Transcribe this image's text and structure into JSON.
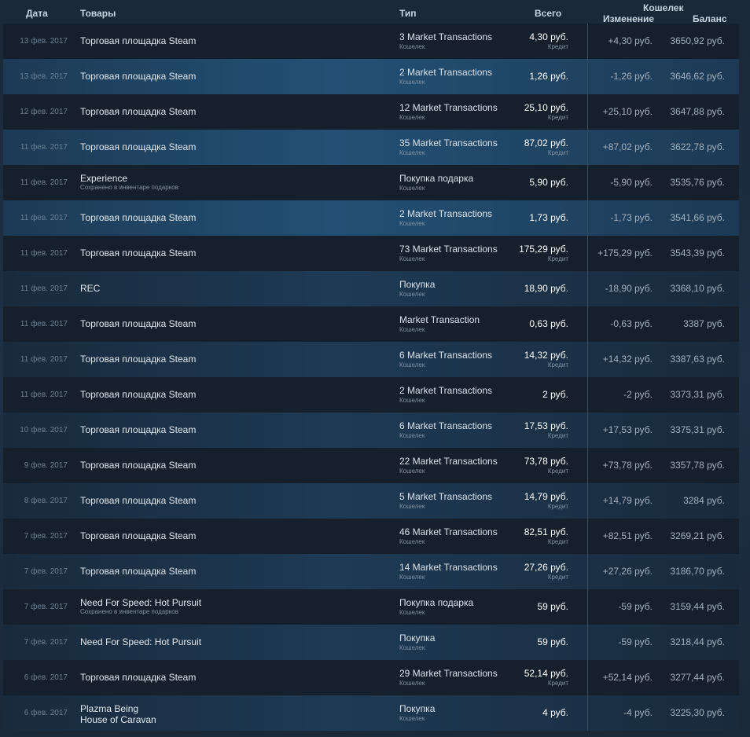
{
  "header": {
    "date": "Дата",
    "items": "Товары",
    "type": "Тип",
    "total": "Всего",
    "wallet": "Кошелек",
    "change": "Изменение",
    "balance": "Баланс"
  },
  "rows": [
    {
      "date": "13 фев. 2017",
      "item": "Торговая площадка Steam",
      "item_sub": "",
      "type": "3 Market Transactions",
      "type_sub": "Кошелек",
      "total": "4,30 руб.",
      "total_sub": "Кредит",
      "change": "+4,30 руб.",
      "balance": "3650,92 руб.",
      "style": "dark"
    },
    {
      "date": "13 фев. 2017",
      "item": "Торговая площадка Steam",
      "item_sub": "",
      "type": "2 Market Transactions",
      "type_sub": "Кошелек",
      "total": "1,26 руб.",
      "total_sub": "",
      "change": "-1,26 руб.",
      "balance": "3646,62 руб.",
      "style": "light"
    },
    {
      "date": "12 фев. 2017",
      "item": "Торговая площадка Steam",
      "item_sub": "",
      "type": "12 Market Transactions",
      "type_sub": "Кошелек",
      "total": "25,10 руб.",
      "total_sub": "Кредит",
      "change": "+25,10 руб.",
      "balance": "3647,88 руб.",
      "style": "dark"
    },
    {
      "date": "11 фев. 2017",
      "item": "Торговая площадка Steam",
      "item_sub": "",
      "type": "35 Market Transactions",
      "type_sub": "Кошелек",
      "total": "87,02 руб.",
      "total_sub": "Кредит",
      "change": "+87,02 руб.",
      "balance": "3622,78 руб.",
      "style": "light"
    },
    {
      "date": "11 фев. 2017",
      "item": "Experience",
      "item_sub": "Сохранено в инвентаре подарков",
      "type": "Покупка подарка",
      "type_sub": "Кошелек",
      "total": "5,90 руб.",
      "total_sub": "",
      "change": "-5,90 руб.",
      "balance": "3535,76 руб.",
      "style": "dark"
    },
    {
      "date": "11 фев. 2017",
      "item": "Торговая площадка Steam",
      "item_sub": "",
      "type": "2 Market Transactions",
      "type_sub": "Кошелек",
      "total": "1,73 руб.",
      "total_sub": "",
      "change": "-1,73 руб.",
      "balance": "3541,66 руб.",
      "style": "light"
    },
    {
      "date": "11 фев. 2017",
      "item": "Торговая площадка Steam",
      "item_sub": "",
      "type": "73 Market Transactions",
      "type_sub": "Кошелек",
      "total": "175,29 руб.",
      "total_sub": "Кредит",
      "change": "+175,29 руб.",
      "balance": "3543,39 руб.",
      "style": "dark"
    },
    {
      "date": "11 фев. 2017",
      "item": "REC",
      "item_sub": "",
      "type": "Покупка",
      "type_sub": "Кошелек",
      "total": "18,90 руб.",
      "total_sub": "",
      "change": "-18,90 руб.",
      "balance": "3368,10 руб.",
      "style": "mid"
    },
    {
      "date": "11 фев. 2017",
      "item": "Торговая площадка Steam",
      "item_sub": "",
      "type": "Market Transaction",
      "type_sub": "Кошелек",
      "total": "0,63 руб.",
      "total_sub": "",
      "change": "-0,63 руб.",
      "balance": "3387 руб.",
      "style": "dark"
    },
    {
      "date": "11 фев. 2017",
      "item": "Торговая площадка Steam",
      "item_sub": "",
      "type": "6 Market Transactions",
      "type_sub": "Кошелек",
      "total": "14,32 руб.",
      "total_sub": "Кредит",
      "change": "+14,32 руб.",
      "balance": "3387,63 руб.",
      "style": "mid"
    },
    {
      "date": "11 фев. 2017",
      "item": "Торговая площадка Steam",
      "item_sub": "",
      "type": "2 Market Transactions",
      "type_sub": "Кошелек",
      "total": "2 руб.",
      "total_sub": "",
      "change": "-2 руб.",
      "balance": "3373,31 руб.",
      "style": "dark"
    },
    {
      "date": "10 фев. 2017",
      "item": "Торговая площадка Steam",
      "item_sub": "",
      "type": "6 Market Transactions",
      "type_sub": "Кошелек",
      "total": "17,53 руб.",
      "total_sub": "Кредит",
      "change": "+17,53 руб.",
      "balance": "3375,31 руб.",
      "style": "mid"
    },
    {
      "date": "9 фев. 2017",
      "item": "Торговая площадка Steam",
      "item_sub": "",
      "type": "22 Market Transactions",
      "type_sub": "Кошелек",
      "total": "73,78 руб.",
      "total_sub": "Кредит",
      "change": "+73,78 руб.",
      "balance": "3357,78 руб.",
      "style": "dark"
    },
    {
      "date": "8 фев. 2017",
      "item": "Торговая площадка Steam",
      "item_sub": "",
      "type": "5 Market Transactions",
      "type_sub": "Кошелек",
      "total": "14,79 руб.",
      "total_sub": "Кредит",
      "change": "+14,79 руб.",
      "balance": "3284 руб.",
      "style": "mid"
    },
    {
      "date": "7 фев. 2017",
      "item": "Торговая площадка Steam",
      "item_sub": "",
      "type": "46 Market Transactions",
      "type_sub": "Кошелек",
      "total": "82,51 руб.",
      "total_sub": "Кредит",
      "change": "+82,51 руб.",
      "balance": "3269,21 руб.",
      "style": "dark"
    },
    {
      "date": "7 фев. 2017",
      "item": "Торговая площадка Steam",
      "item_sub": "",
      "type": "14 Market Transactions",
      "type_sub": "Кошелек",
      "total": "27,26 руб.",
      "total_sub": "Кредит",
      "change": "+27,26 руб.",
      "balance": "3186,70 руб.",
      "style": "mid"
    },
    {
      "date": "7 фев. 2017",
      "item": "Need For Speed: Hot Pursuit",
      "item_sub": "Сохранено в инвентаре подарков",
      "type": "Покупка подарка",
      "type_sub": "Кошелек",
      "total": "59 руб.",
      "total_sub": "",
      "change": "-59 руб.",
      "balance": "3159,44 руб.",
      "style": "dark"
    },
    {
      "date": "7 фев. 2017",
      "item": "Need For Speed: Hot Pursuit",
      "item_sub": "",
      "type": "Покупка",
      "type_sub": "Кошелек",
      "total": "59 руб.",
      "total_sub": "",
      "change": "-59 руб.",
      "balance": "3218,44 руб.",
      "style": "mid"
    },
    {
      "date": "6 фев. 2017",
      "item": "Торговая площадка Steam",
      "item_sub": "",
      "type": "29 Market Transactions",
      "type_sub": "Кошелек",
      "total": "52,14 руб.",
      "total_sub": "Кредит",
      "change": "+52,14 руб.",
      "balance": "3277,44 руб.",
      "style": "dark"
    },
    {
      "date": "6 фев. 2017",
      "item": "Plazma Being",
      "item_line2": "House of Caravan",
      "item_sub": "",
      "type": "Покупка",
      "type_sub": "Кошелек",
      "total": "4 руб.",
      "total_sub": "",
      "change": "-4 руб.",
      "balance": "3225,30 руб.",
      "style": "mid"
    }
  ]
}
